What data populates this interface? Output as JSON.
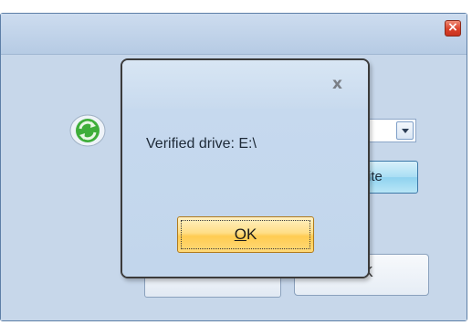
{
  "parent_window": {
    "close_icon": "close-icon",
    "close_glyph": "×",
    "refresh_icon": "refresh-icon",
    "dropdown_icon": "chevron-down-icon",
    "partial_button_label": "ite",
    "partial_bottom_glyph": "K"
  },
  "dialog": {
    "close_glyph": "x",
    "message": "Verified drive: E:\\",
    "ok_button": {
      "mnemonic": "O",
      "rest": "K"
    }
  },
  "colors": {
    "ok_button_highlight": "#ffd978",
    "dialog_background": "#c6d9ee",
    "close_red": "#d9412a"
  }
}
